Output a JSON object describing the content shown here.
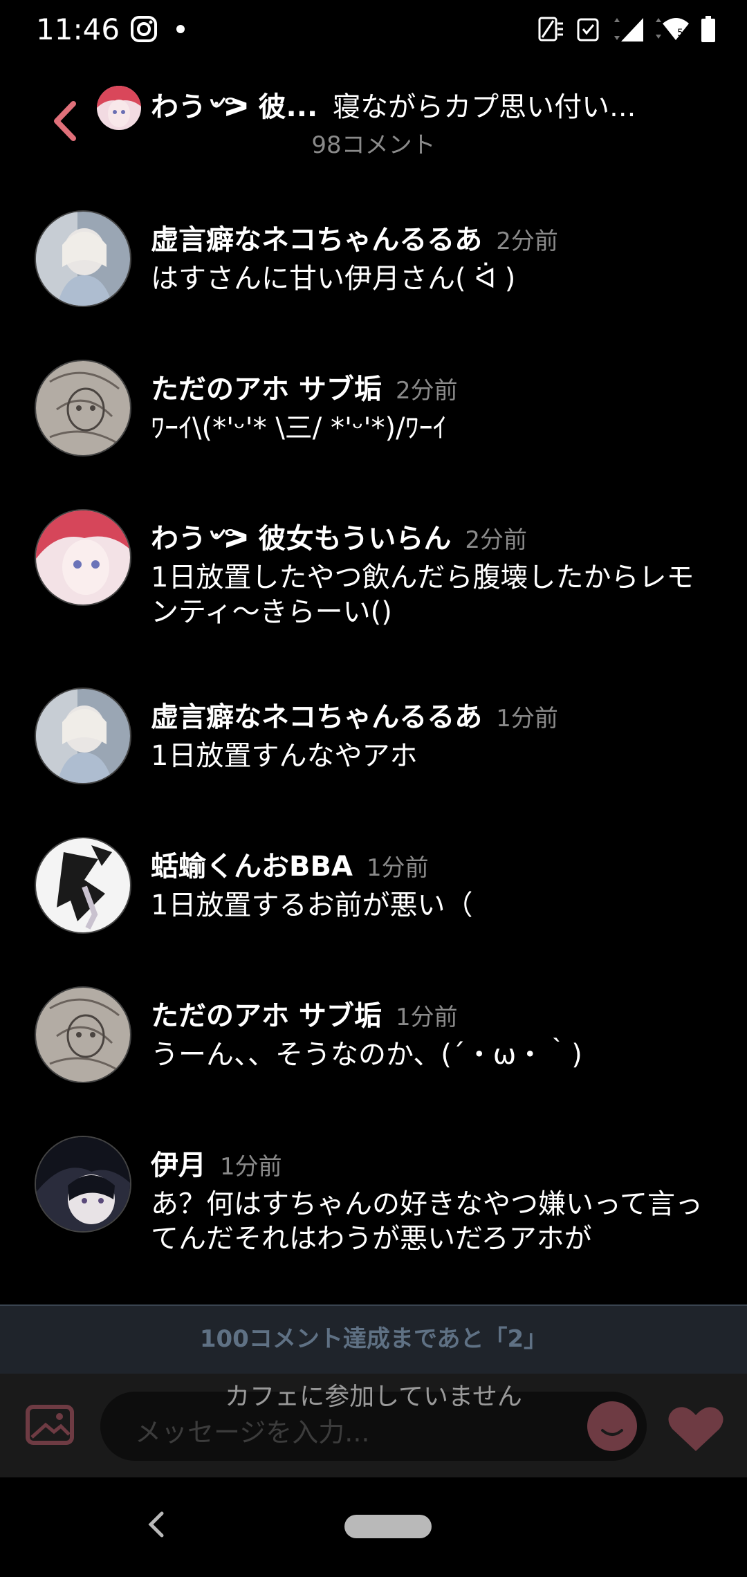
{
  "status_bar": {
    "time": "11:46",
    "left_icons": [
      "instagram-icon",
      "dot-icon"
    ],
    "right_icons": [
      "nfc-icon",
      "battery-saver-icon",
      "signal-icon",
      "wifi-icon",
      "battery-icon"
    ]
  },
  "header": {
    "poster_name": "わう৺ᕗ 彼...",
    "post_title": "寝ながらカプ思い付い...",
    "comment_count": "98コメント"
  },
  "comments": [
    {
      "name": "虚言癖なネコちゃんるるあ",
      "time": "2分前",
      "text": "はすさんに甘い伊月さん( ᐛ )",
      "avatar": "doll-avatar"
    },
    {
      "name": "ただのアホ サブ垢",
      "time": "2分前",
      "text": "ﾜｰｲ\\(*'ᵕ'* \\三/ *'ᵕ'*)/ﾜｰｲ",
      "avatar": "sketch-avatar"
    },
    {
      "name": "わう৺ᕗ 彼女もういらん",
      "time": "2分前",
      "text": "1日放置したやつ飲んだら腹壊したからレモンティ〜きらーい()",
      "avatar": "redhair-avatar"
    },
    {
      "name": "虚言癖なネコちゃんるるあ",
      "time": "1分前",
      "text": "1日放置すんなやアホ",
      "avatar": "doll-avatar"
    },
    {
      "name": "蛞蝓くんおBBA",
      "time": "1分前",
      "text": "1日放置するお前が悪い（",
      "avatar": "bw-avatar"
    },
    {
      "name": "ただのアホ サブ垢",
      "time": "1分前",
      "text": "うーん、、そうなのか、(´・ω・｀)",
      "avatar": "sketch-avatar"
    },
    {
      "name": "伊月",
      "time": "1分前",
      "text": "あ？何はすちゃんの好きなやつ嫌いって言ってんだそれはわうが悪いだろアホが",
      "avatar": "darkhair-avatar"
    }
  ],
  "milestone": "100コメント達成まであと「2」",
  "not_joined": "カフェに参加していません",
  "input": {
    "placeholder": "メッセージを入力..."
  },
  "colors": {
    "accent": "#e0707a",
    "milestone_bg": "#1f242b",
    "milestone_text": "#5f7184"
  }
}
